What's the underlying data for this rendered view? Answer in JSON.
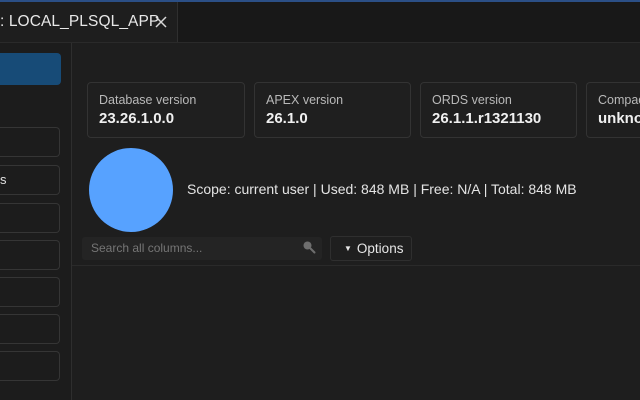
{
  "tab": {
    "title": ": LOCAL_PLSQL_APP"
  },
  "sidebar": {
    "items": [
      {
        "label": ""
      },
      {
        "label": "s"
      },
      {
        "label": ""
      },
      {
        "label": ""
      },
      {
        "label": ""
      },
      {
        "label": ""
      },
      {
        "label": ""
      }
    ]
  },
  "cards": [
    {
      "label": "Database version",
      "value": "23.26.1.0.0"
    },
    {
      "label": "APEX version",
      "value": "26.1.0"
    },
    {
      "label": "ORDS version",
      "value": "26.1.1.r1321130"
    },
    {
      "label": "Compac",
      "value": "unkno"
    }
  ],
  "storage": {
    "scope_text": "Scope: current user | Used: 848 MB | Free: N/A | Total: 848 MB",
    "chart_color": "#57a2ff"
  },
  "search": {
    "placeholder": "Search all columns..."
  },
  "options": {
    "label": "Options"
  },
  "colors": {
    "accent": "#174b77",
    "top_border": "#2b4f86"
  }
}
